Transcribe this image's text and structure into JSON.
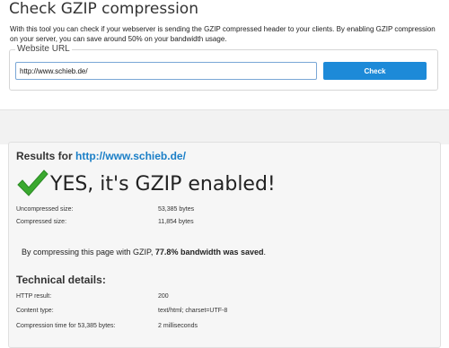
{
  "page": {
    "title": "Check GZIP compression",
    "intro": "With this tool you can check if your webserver is sending the GZIP compressed header to your clients. By enabling GZIP compression on your server, you can save around 50% on your bandwidth usage."
  },
  "form": {
    "legend": "Website URL",
    "url_value": "http://www.schieb.de/",
    "check_label": "Check"
  },
  "results": {
    "heading_prefix": "Results for",
    "url": "http://www.schieb.de/",
    "verdict": "YES, it's GZIP enabled!",
    "uncompressed_label": "Uncompressed size:",
    "uncompressed_value": "53,385 bytes",
    "compressed_label": "Compressed size:",
    "compressed_value": "11,854 bytes",
    "saved_prefix": "By compressing this page with GZIP,",
    "saved_percent": "77.8%",
    "saved_suffix": "bandwidth was saved",
    "saved_end": "."
  },
  "technical": {
    "heading": "Technical details:",
    "http_label": "HTTP result:",
    "http_value": "200",
    "content_type_label": "Content type:",
    "content_type_value": "text/html; charset=UTF-8",
    "compression_time_label": "Compression time for 53,385 bytes:",
    "compression_time_value": "2 milliseconds"
  },
  "colors": {
    "accent": "#1d8ad8",
    "link": "#1b7fc7",
    "success": "#3aa92f"
  },
  "icons": {
    "verdict_icon": "checkmark-icon"
  }
}
